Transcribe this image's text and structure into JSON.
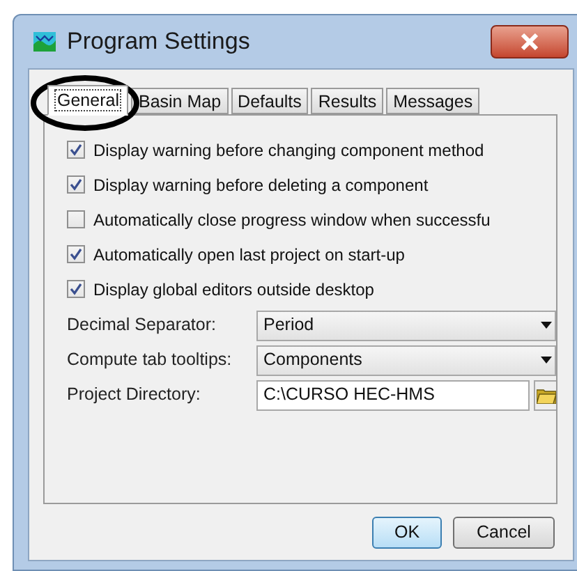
{
  "window": {
    "title": "Program Settings"
  },
  "tabs": [
    {
      "label": "General",
      "selected": true
    },
    {
      "label": "Basin Map",
      "selected": false
    },
    {
      "label": "Defaults",
      "selected": false
    },
    {
      "label": "Results",
      "selected": false
    },
    {
      "label": "Messages",
      "selected": false
    }
  ],
  "options": [
    {
      "label": "Display warning before changing component method",
      "checked": true
    },
    {
      "label": "Display warning before deleting a component",
      "checked": true
    },
    {
      "label": "Automatically close progress window when successfu",
      "checked": false
    },
    {
      "label": "Automatically open last project on start-up",
      "checked": true
    },
    {
      "label": "Display global editors outside desktop",
      "checked": true
    }
  ],
  "fields": [
    {
      "kind": "dropdown",
      "label": "Decimal Separator:",
      "value": "Period"
    },
    {
      "kind": "dropdown",
      "label": "Compute tab tooltips:",
      "value": "Components"
    },
    {
      "kind": "path",
      "label": "Project Directory:",
      "value": "C:\\CURSO HEC-HMS"
    }
  ],
  "buttons": [
    {
      "label": "OK",
      "kind": "default"
    },
    {
      "label": "Cancel",
      "kind": "normal"
    }
  ]
}
